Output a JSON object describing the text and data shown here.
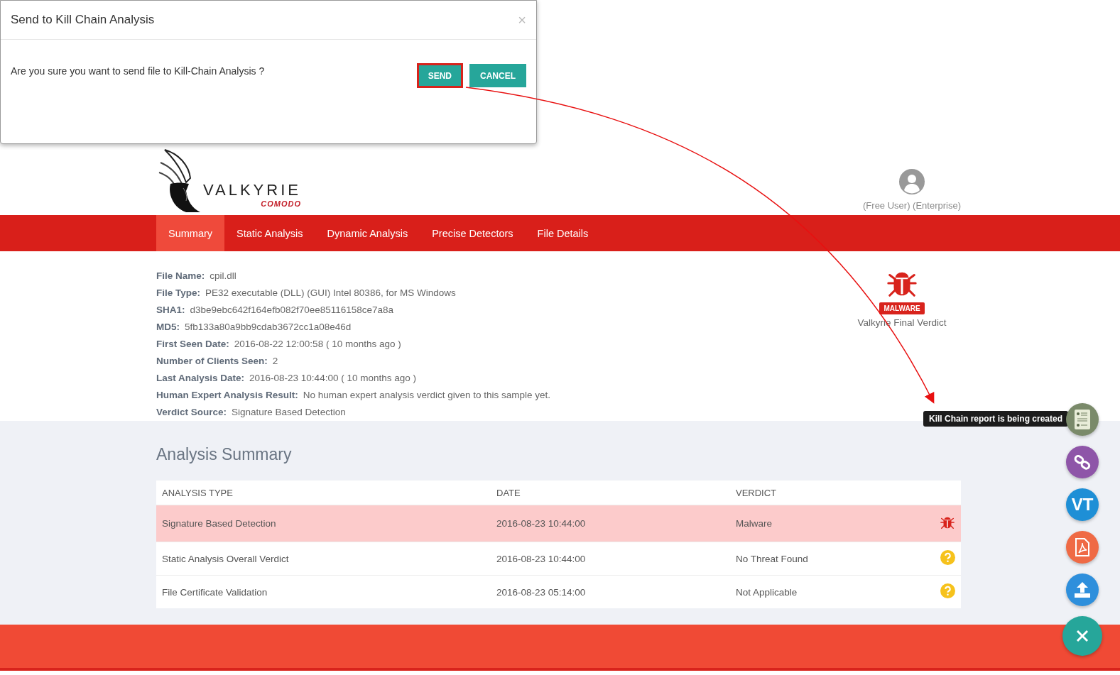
{
  "dialog": {
    "title": "Send to Kill Chain Analysis",
    "close": "×",
    "message": "Are you sure you want to send file to Kill-Chain Analysis ?",
    "buttons": [
      {
        "label": "SEND",
        "highlighted": true
      },
      {
        "label": "CANCEL",
        "highlighted": false
      }
    ]
  },
  "logo": {
    "name": "VALKYRIE",
    "brand": "COMODO"
  },
  "user": {
    "account": "(Free User) (Enterprise)"
  },
  "tabs": [
    {
      "label": "Summary",
      "selected": true
    },
    {
      "label": "Static Analysis",
      "selected": false
    },
    {
      "label": "Dynamic Analysis",
      "selected": false
    },
    {
      "label": "Precise Detectors",
      "selected": false
    },
    {
      "label": "File Details",
      "selected": false
    }
  ],
  "file_info": [
    {
      "label": "File Name:",
      "value": "cpil.dll"
    },
    {
      "label": "File Type:",
      "value": "PE32 executable (DLL) (GUI) Intel 80386, for MS Windows"
    },
    {
      "label": "SHA1:",
      "value": "d3be9ebc642f164efb082f70ee85116158ce7a8a"
    },
    {
      "label": "MD5:",
      "value": "5fb133a80a9bb9cdab3672cc1a08e46d"
    },
    {
      "label": "First Seen Date:",
      "value": "2016-08-22 12:00:58 ( 10 months ago )"
    },
    {
      "label": "Number of Clients Seen:",
      "value": "2"
    },
    {
      "label": "Last Analysis Date:",
      "value": "2016-08-23 10:44:00 ( 10 months ago )"
    },
    {
      "label": "Human Expert Analysis Result:",
      "value": "No human expert analysis verdict given to this sample yet."
    },
    {
      "label": "Verdict Source:",
      "value": "Signature Based Detection"
    }
  ],
  "verdict": {
    "kind": "malware",
    "badge": "MALWARE",
    "caption": "Valkyrie Final Verdict"
  },
  "analysis_summary": {
    "title": "Analysis Summary",
    "columns": [
      "ANALYSIS TYPE",
      "DATE",
      "VERDICT"
    ],
    "rows": [
      {
        "type": "Signature Based Detection",
        "date": "2016-08-23 10:44:00",
        "verdict": "Malware",
        "kind": "malware"
      },
      {
        "type": "Static Analysis Overall Verdict",
        "date": "2016-08-23 10:44:00",
        "verdict": "No Threat Found",
        "kind": "unknown"
      },
      {
        "type": "File Certificate Validation",
        "date": "2016-08-23 05:14:00",
        "verdict": "Not Applicable",
        "kind": "unknown"
      }
    ]
  },
  "fab": {
    "tooltip": "Kill Chain report is being created",
    "buttons": [
      {
        "kind": "report",
        "color": "#7a8a6a"
      },
      {
        "kind": "link",
        "color": "#8e55a8"
      },
      {
        "kind": "vt",
        "label": "VT",
        "color": "#1e8fd6"
      },
      {
        "kind": "pdf",
        "color": "#ef6a45"
      },
      {
        "kind": "upload",
        "color": "#2e8fdc"
      },
      {
        "kind": "close",
        "color": "#26a69a"
      }
    ]
  }
}
